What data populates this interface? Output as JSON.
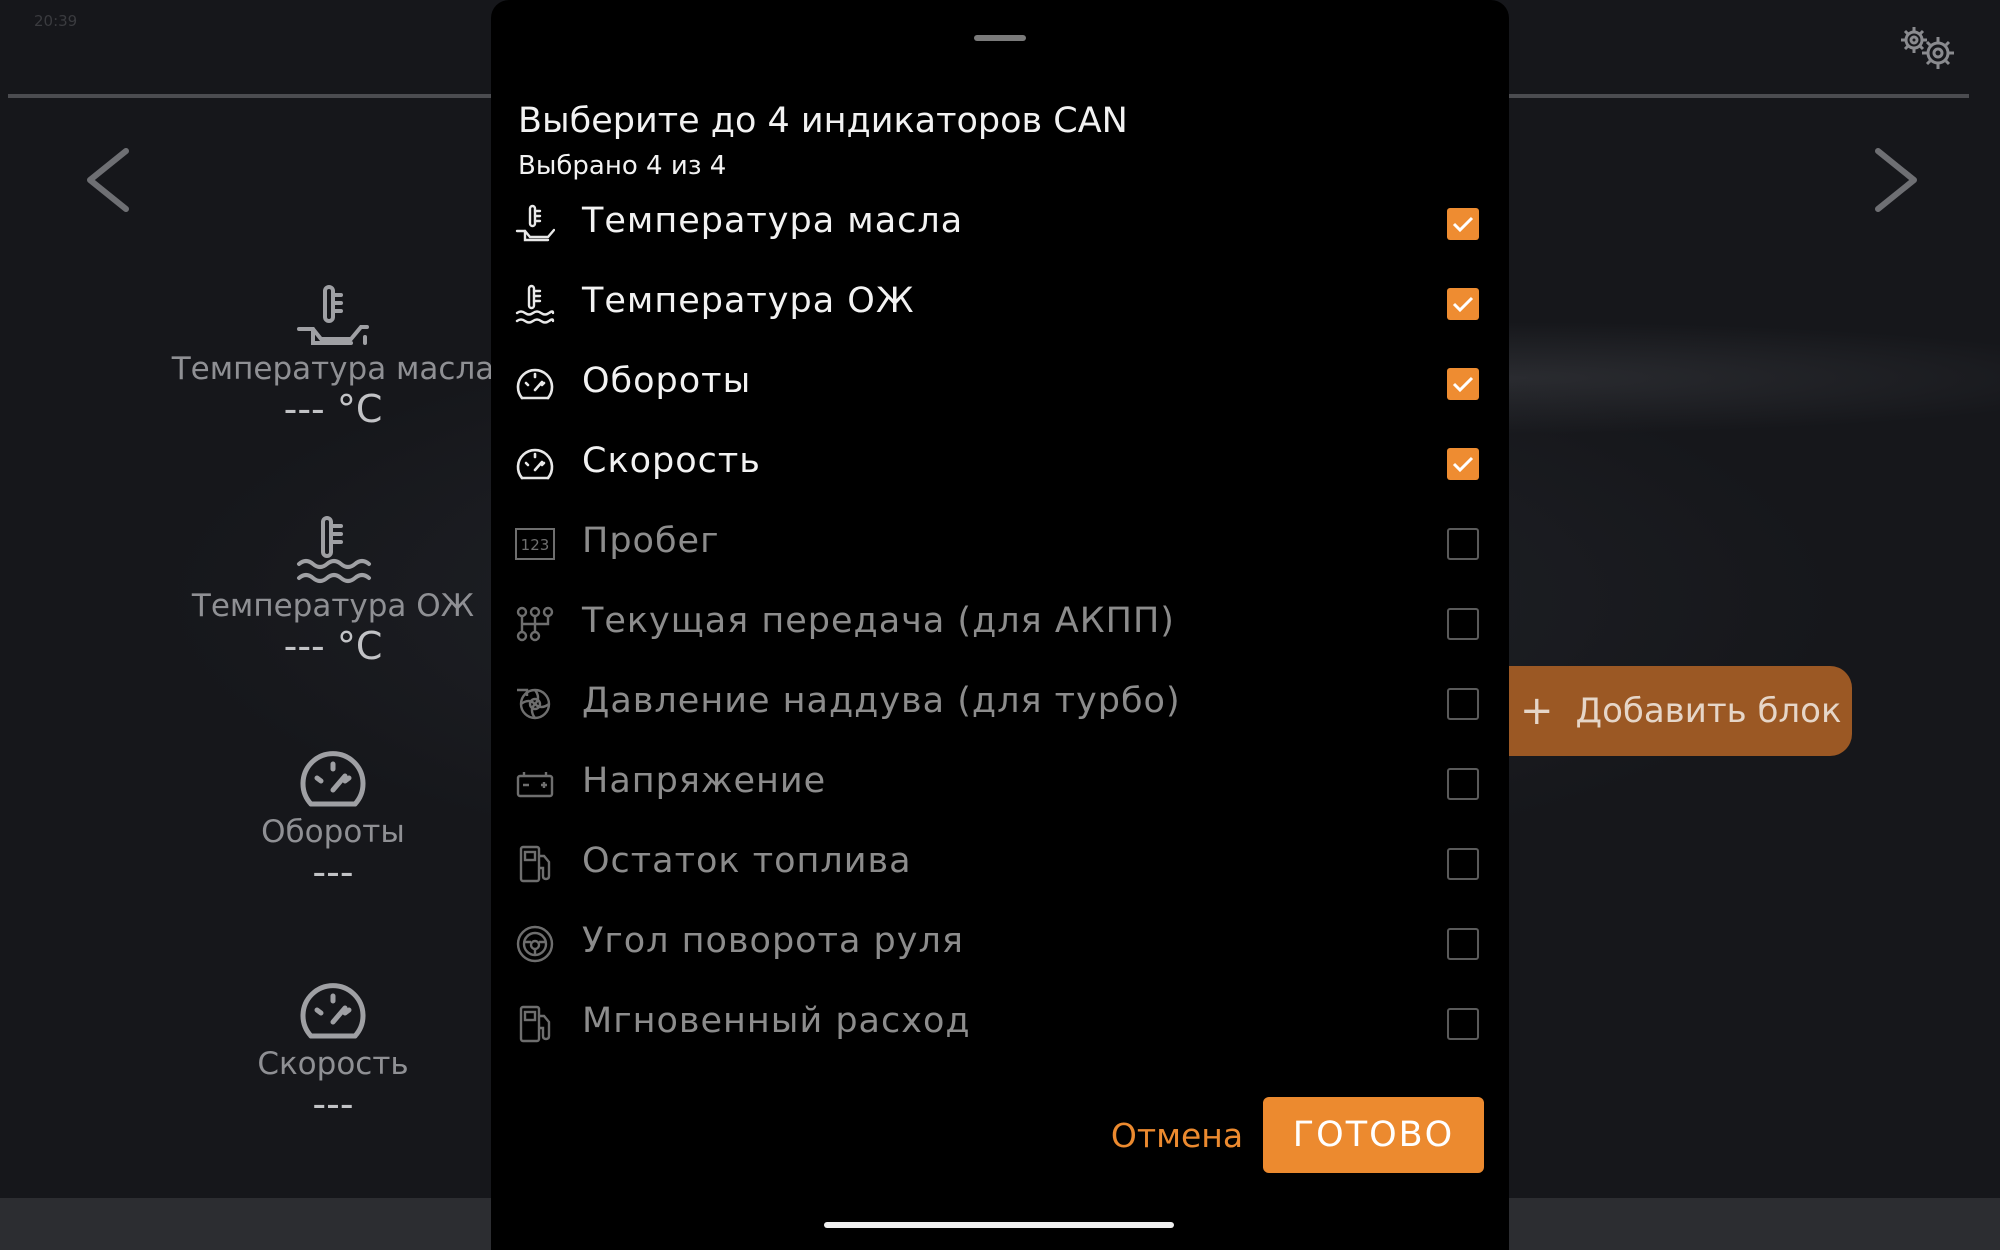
{
  "status_bar": {
    "time": "20:39"
  },
  "dashboard": {
    "gauges": [
      {
        "label": "Температура масла",
        "value": "--- °C",
        "icon": "oil-temperature-icon"
      },
      {
        "label": "Температура ОЖ",
        "value": "--- °C",
        "icon": "coolant-temperature-icon"
      },
      {
        "label": "Обороты",
        "value": "---",
        "icon": "tachometer-icon"
      },
      {
        "label": "Скорость",
        "value": "---",
        "icon": "speedometer-icon"
      }
    ],
    "add_block_label": "Добавить блок"
  },
  "modal": {
    "title": "Выберите до 4 индикаторов CAN",
    "subtitle": "Выбрано 4 из 4",
    "options": [
      {
        "label": "Температура масла",
        "checked": true,
        "icon": "oil-temperature-icon"
      },
      {
        "label": "Температура ОЖ",
        "checked": true,
        "icon": "coolant-temperature-icon"
      },
      {
        "label": "Обороты",
        "checked": true,
        "icon": "tachometer-icon"
      },
      {
        "label": "Скорость",
        "checked": true,
        "icon": "speedometer-icon"
      },
      {
        "label": "Пробег",
        "checked": false,
        "icon": "odometer-icon"
      },
      {
        "label": "Текущая передача (для АКПП)",
        "checked": false,
        "icon": "gearbox-icon"
      },
      {
        "label": "Давление наддува (для турбо)",
        "checked": false,
        "icon": "turbo-icon"
      },
      {
        "label": "Напряжение",
        "checked": false,
        "icon": "battery-icon"
      },
      {
        "label": "Остаток топлива",
        "checked": false,
        "icon": "fuel-pump-icon"
      },
      {
        "label": "Угол поворота руля",
        "checked": false,
        "icon": "steering-wheel-icon"
      },
      {
        "label": "Мгновенный расход",
        "checked": false,
        "icon": "fuel-consumption-icon"
      }
    ],
    "cancel_label": "Отмена",
    "done_label": "ГОТОВО"
  },
  "colors": {
    "accent": "#ec8a2f",
    "modal_background": "#000000",
    "dashboard_background": "#16171b"
  }
}
